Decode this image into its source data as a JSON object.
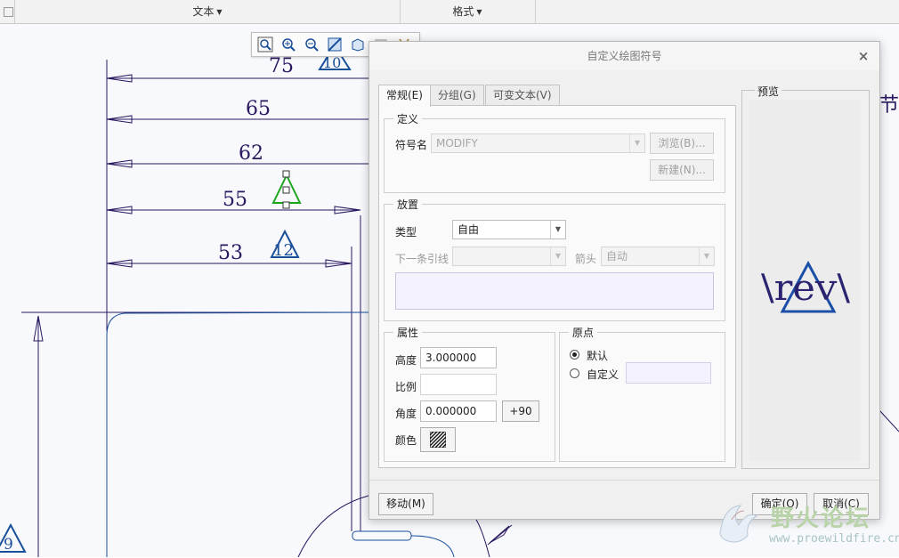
{
  "ribbon": {
    "groups": [
      {
        "label": "文本"
      },
      {
        "label": "格式"
      }
    ]
  },
  "drawing": {
    "dimensions": [
      "75",
      "65",
      "62",
      "55",
      "53"
    ],
    "rev_labels": [
      "10",
      "12",
      "9"
    ],
    "side_text": "节"
  },
  "mini_toolbar": {
    "icons": [
      "zoom-fit-icon",
      "zoom-in-icon",
      "zoom-out-icon",
      "repaint-icon",
      "view-icon",
      "layer-icon",
      "tools-icon"
    ]
  },
  "dialog": {
    "title": "自定义绘图符号",
    "close": "×",
    "tabs": [
      {
        "label": "常规(E)",
        "active": true
      },
      {
        "label": "分组(G)",
        "active": false
      },
      {
        "label": "可变文本(V)",
        "active": false
      }
    ],
    "definition": {
      "title": "定义",
      "symbol_name_label": "符号名",
      "symbol_name_value": "MODIFY",
      "browse_label": "浏览(B)...",
      "new_label": "新建(N)..."
    },
    "placement": {
      "title": "放置",
      "type_label": "类型",
      "type_value": "自由",
      "next_leader_label": "下一条引线",
      "next_leader_value": "",
      "arrow_label": "箭头",
      "arrow_value": "自动"
    },
    "properties": {
      "title": "属性",
      "height_label": "高度",
      "height_value": "3.000000",
      "scale_label": "比例",
      "scale_value": "",
      "angle_label": "角度",
      "angle_value": "0.000000",
      "rotate_label": "+90",
      "color_label": "颜色"
    },
    "origin": {
      "title": "原点",
      "default_label": "默认",
      "custom_label": "自定义",
      "selected": "default"
    },
    "preview": {
      "title": "预览",
      "text": "\\rev\\"
    },
    "footer": {
      "move_label": "移动(M)",
      "ok_label": "确定(O)",
      "cancel_label": "取消(C)"
    }
  },
  "watermark": {
    "title": "野火论坛",
    "url": "www.proewildfire.cn"
  },
  "colors": {
    "dim_line": "#2a1860",
    "rev_blue": "#1a4f99",
    "selected_green": "#1ea51e",
    "preview_blue": "#1b4fa8"
  }
}
